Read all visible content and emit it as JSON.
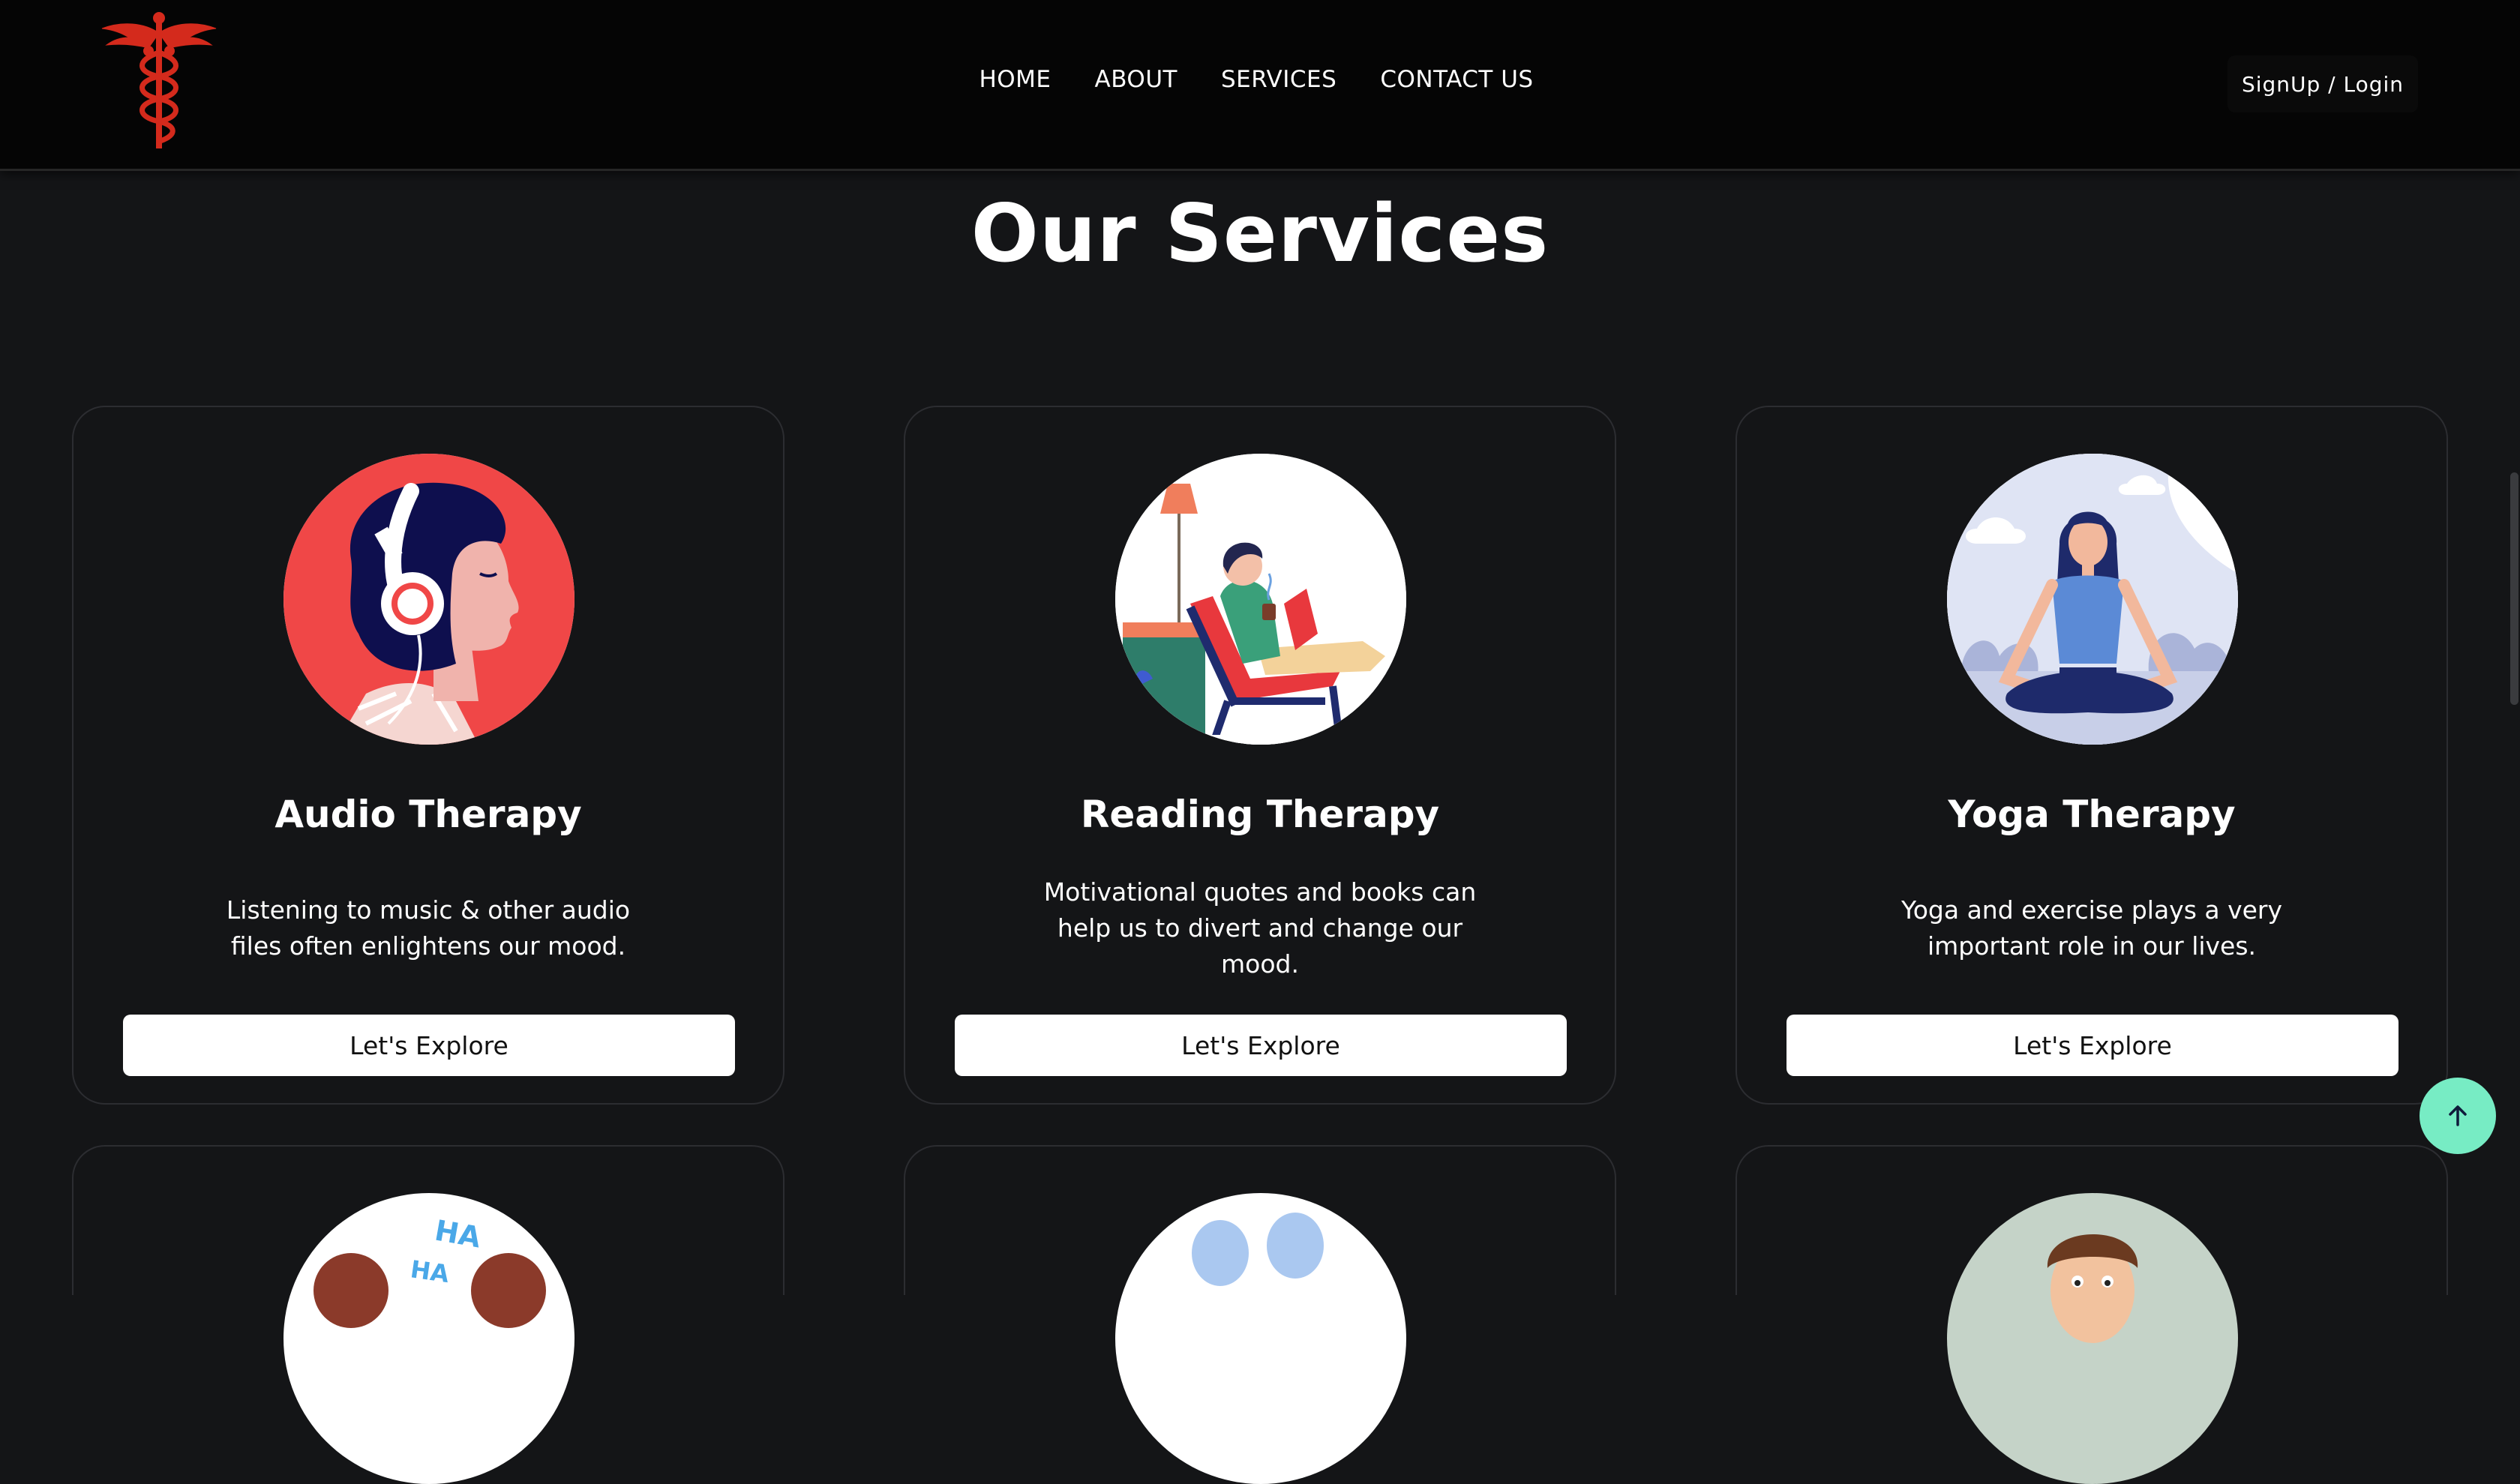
{
  "nav": {
    "links": [
      "HOME",
      "ABOUT",
      "SERVICES",
      "CONTACT US"
    ],
    "auth_label": "SignUp / Login"
  },
  "section": {
    "title": "Our Services"
  },
  "services": [
    {
      "title": "Audio Therapy",
      "description": "Listening to music & other audio files often enlightens our mood.",
      "button": "Let's Explore"
    },
    {
      "title": "Reading Therapy",
      "description": "Motivational quotes and books can help us to divert and change our mood.",
      "button": "Let's Explore"
    },
    {
      "title": "Yoga Therapy",
      "description": "Yoga and exercise plays a very important role in our lives.",
      "button": "Let's Explore"
    }
  ],
  "laughter_text": [
    "HA",
    "HA"
  ],
  "colors": {
    "background": "#141517",
    "navbar": "#050505",
    "logo_red": "#d42a1c",
    "scroll_top": "#77ecc4",
    "audio_bg": "#f04747"
  },
  "icons": {
    "logo": "caduceus-icon",
    "scroll_top": "arrow-up-icon"
  }
}
